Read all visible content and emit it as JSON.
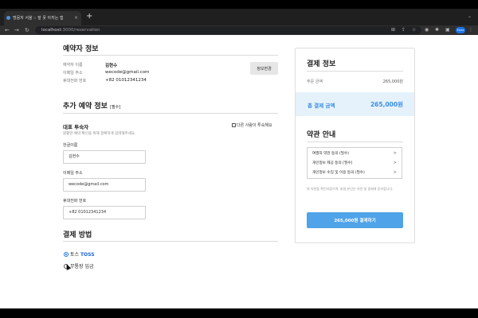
{
  "browser": {
    "tab_title": "멍뭉자 서울 :: 잘 못 아끼는 앱",
    "tab_close": "×",
    "new_tab": "+",
    "tab_menu": "⌄",
    "url_host": "localhost",
    "url_path": ":3000/reservation",
    "profile_label": "Enne"
  },
  "reserver": {
    "title": "예약자 정보",
    "name_label": "예약자 이름",
    "name_value": "김현수",
    "email_label": "이메일 주소",
    "email_value": "wecode@gmail.com",
    "phone_label": "휴대전화 번호",
    "phone_value": "+82 01012341234",
    "edit_button": "정보변경"
  },
  "extra": {
    "title": "추가 예약 정보",
    "required_tag": "[필수]",
    "subtitle": "대표 투숙자",
    "description": "원활한 예약 확인을 위해 정확하게 입력해주세요.",
    "other_guest_checkbox": "다른 사람이 투숙해요",
    "name_label": "한글이름",
    "name_value": "김현수",
    "email_label": "이메일 주소",
    "email_value": "wecode@gmail.com",
    "phone_label": "휴대전화 번호",
    "phone_value": "+82 01012341234"
  },
  "payment_method": {
    "title": "결제 방법",
    "option_toss_prefix": "토스",
    "option_toss_brand": "TOSS",
    "option_bank": "무통장 입금",
    "selected": "toss"
  },
  "summary": {
    "title": "결제 정보",
    "order_label": "주문 금액",
    "order_value": "265,000원",
    "total_label": "총 결제 금액",
    "total_value": "265,000원"
  },
  "terms": {
    "title": "약관 안내",
    "items": [
      {
        "label": "여행자 약관 동의 (필수)",
        "arrow": ">"
      },
      {
        "label": "개인정보 제공 동의 [필수]",
        "arrow": ">"
      },
      {
        "label": "개인정보 수집 및 이용 동의 (필수)",
        "arrow": ">"
      }
    ],
    "notice": "위 약관을 확인하였으며, 회원 본인은 약관 및 결제에 동의합니다.",
    "pay_button": "265,000원 결제하기"
  },
  "colors": {
    "accent": "#4fa3e8",
    "toss_brand": "#1b64da",
    "total_bg": "#e6f2fb"
  }
}
